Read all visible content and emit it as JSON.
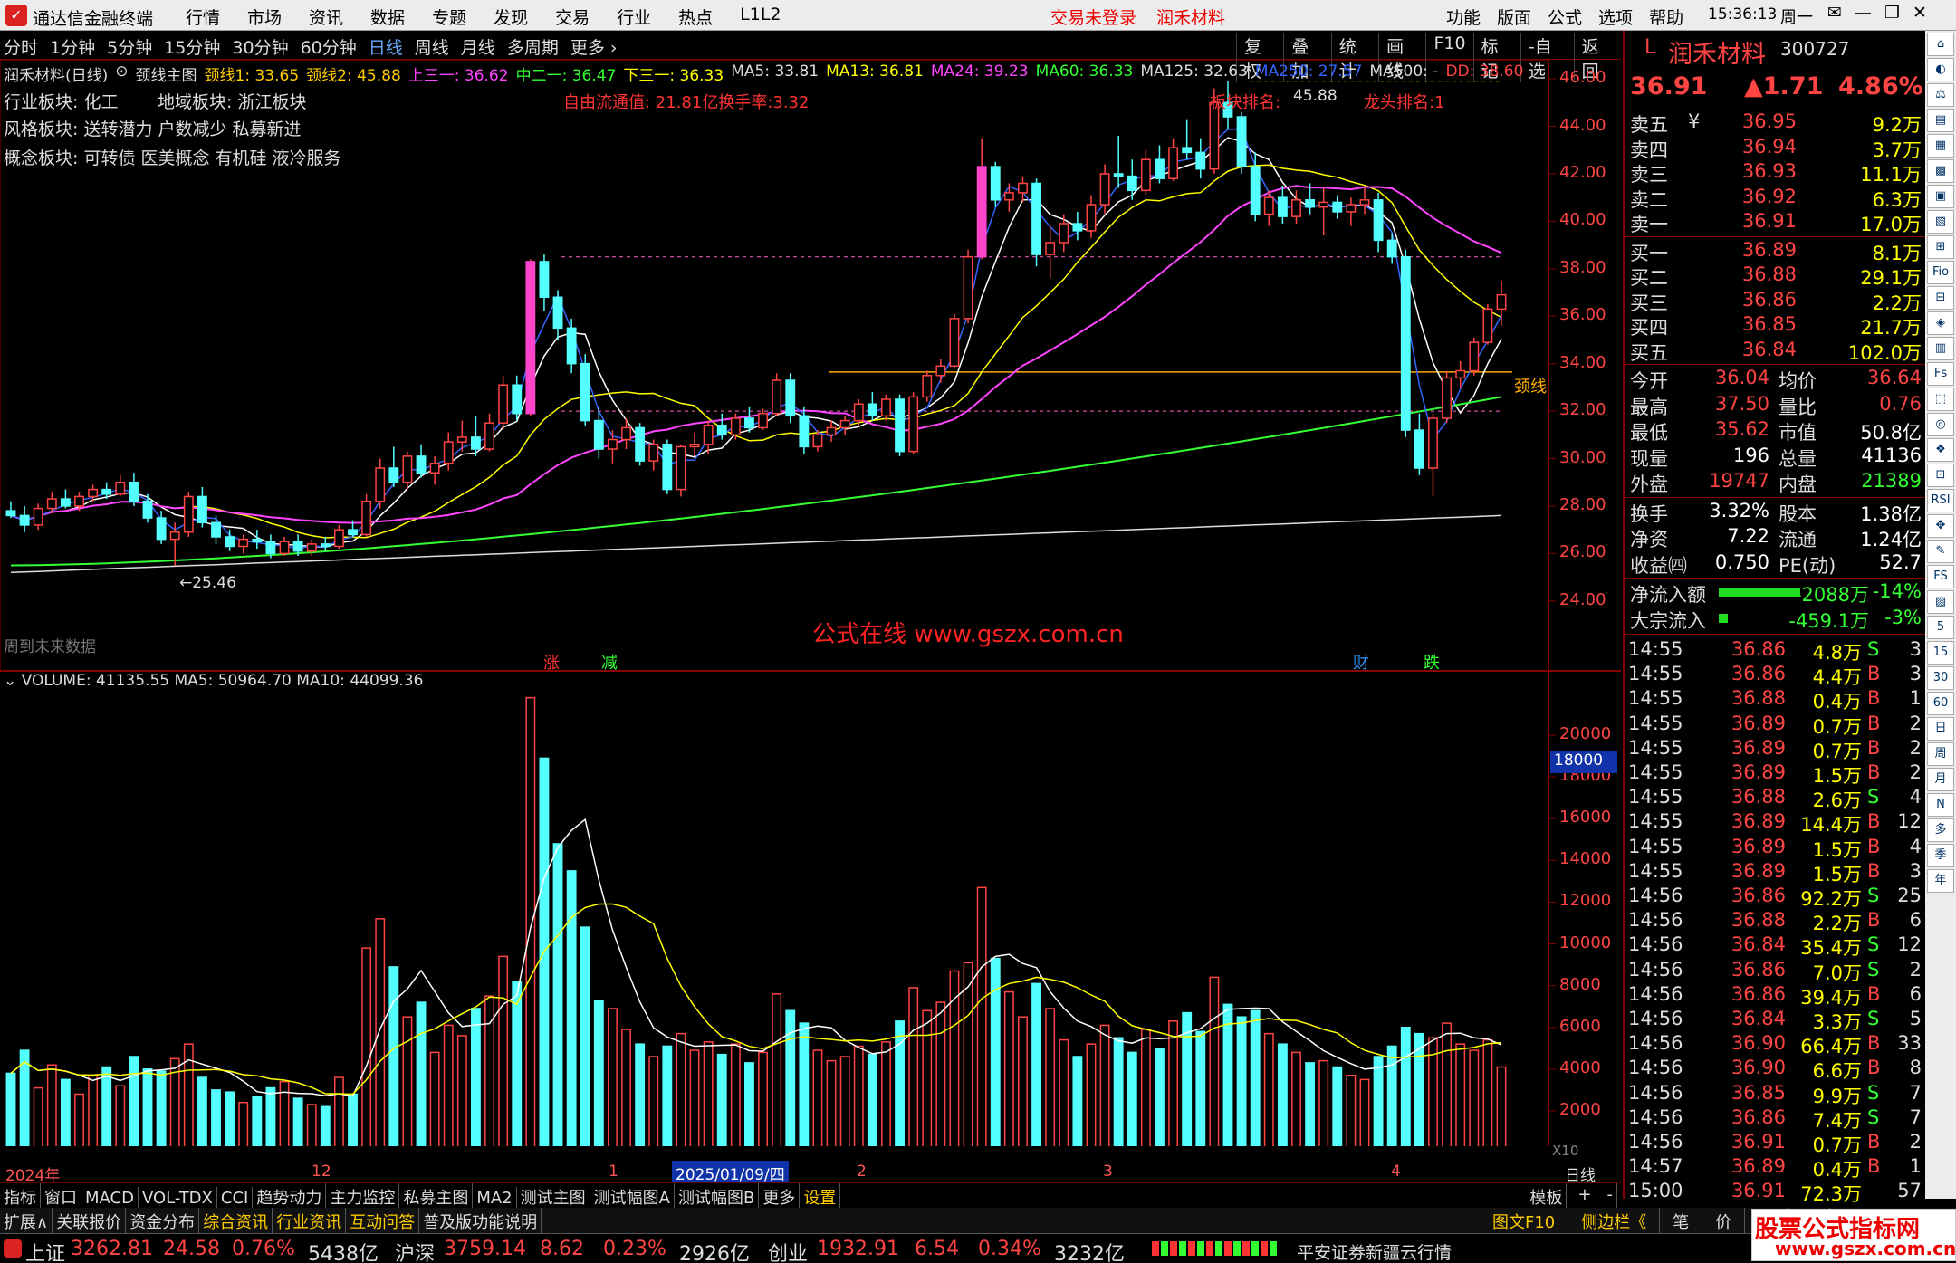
{
  "window": {
    "app_title": "通达信金融终端",
    "menus": [
      "行情",
      "市场",
      "资讯",
      "数据",
      "专题",
      "发现",
      "交易",
      "行业",
      "热点",
      "L1L2"
    ],
    "login": "交易未登录",
    "stock_title": "润禾材料",
    "right_menus": [
      "功能",
      "版面",
      "公式",
      "选项",
      "帮助"
    ],
    "clock": "15:36:13",
    "weekday": "周一",
    "win_buttons": [
      "✉",
      "—",
      "❐",
      "✕"
    ]
  },
  "periods": [
    {
      "label": "分时",
      "active": false
    },
    {
      "label": "1分钟",
      "active": false
    },
    {
      "label": "5分钟",
      "active": false
    },
    {
      "label": "15分钟",
      "active": false
    },
    {
      "label": "30分钟",
      "active": false
    },
    {
      "label": "60分钟",
      "active": false
    },
    {
      "label": "日线",
      "active": true
    },
    {
      "label": "周线",
      "active": false
    },
    {
      "label": "月线",
      "active": false
    },
    {
      "label": "多周期",
      "active": false
    },
    {
      "label": "更多 ›",
      "active": false
    }
  ],
  "tools": [
    "复权",
    "叠加",
    "统计",
    "画线",
    "F10",
    "标记",
    "-自选",
    "返回"
  ],
  "indicator_line": [
    {
      "text": "润禾材料(日线)",
      "color": "#dddddd"
    },
    {
      "text": "⊙",
      "color": "#dddddd"
    },
    {
      "text": "颈线主图",
      "color": "#dddddd"
    },
    {
      "text": "颈线1: 33.65",
      "color": "#ffcc00"
    },
    {
      "text": "颈线2: 45.88",
      "color": "#ffcc00"
    },
    {
      "text": "上三一: 36.62",
      "color": "#ff44ff"
    },
    {
      "text": "中二一: 36.47",
      "color": "#33ff33"
    },
    {
      "text": "下三一: 36.33",
      "color": "#ffff00"
    },
    {
      "text": "MA5: 33.81",
      "color": "#dddddd"
    },
    {
      "text": "MA13: 36.81",
      "color": "#ffff00"
    },
    {
      "text": "MA24: 39.23",
      "color": "#ff44ff"
    },
    {
      "text": "MA60: 36.33",
      "color": "#33ff33"
    },
    {
      "text": "MA125: 32.63",
      "color": "#dddddd"
    },
    {
      "text": "MA250: 27.57",
      "color": "#3366ff"
    },
    {
      "text": "MA500: -",
      "color": "#dddddd"
    },
    {
      "text": "DD: 38.60",
      "color": "#ff4444"
    }
  ],
  "sectors": {
    "industry": "行业板块: 化工",
    "region": "地域板块: 浙江板块",
    "style": "风格板块: 送转潜力 户数减少 私募新进",
    "concept": "概念板块: 可转债 医美概念 有机硅 液冷服务"
  },
  "annotations": {
    "float": "自由流通值: 21.81亿换手率:3.32",
    "sector_rank": "板块排名:",
    "high_label": "45.88",
    "leader_rank": "龙头排名:1",
    "neck": "颈线",
    "low_label": "←25.46",
    "watermark": "公式在线 www.gszx.com.cn",
    "future": "周到未来数据",
    "flags": [
      {
        "t": "涨",
        "c": "#ff3333"
      },
      {
        "t": "减",
        "c": "#33ff33"
      },
      {
        "t": "财",
        "c": "#3399ff"
      },
      {
        "t": "跌",
        "c": "#33ff33"
      }
    ]
  },
  "price_axis": [
    "46.00",
    "44.00",
    "42.00",
    "40.00",
    "38.00",
    "36.00",
    "34.00",
    "32.00",
    "30.00",
    "28.00",
    "26.00",
    "24.00"
  ],
  "volume_axis": [
    "20000",
    "18000",
    "16000",
    "14000",
    "12000",
    "10000",
    "8000",
    "6000",
    "4000",
    "2000"
  ],
  "volume_title": "VOLUME: 41135.55  MA5: 50964.70  MA10: 44099.36",
  "volume_marker": "18000",
  "x10": "X10",
  "date_axis": {
    "year": "2024年",
    "m12": "12",
    "m1": "1",
    "sel": "2025/01/09/四",
    "m2": "2",
    "m3": "3",
    "m4": "4",
    "right": "日线"
  },
  "chart_data": {
    "type": "candlestick",
    "title": "润禾材料(日线)",
    "ylim": [
      23,
      46.5
    ],
    "volume_ylim": [
      0,
      22000
    ],
    "candles": [
      [
        27.8,
        28.2,
        27.5,
        27.6,
        3800
      ],
      [
        27.6,
        28.0,
        26.9,
        27.2,
        4900
      ],
      [
        27.2,
        28.1,
        27.0,
        27.9,
        3100
      ],
      [
        27.9,
        28.6,
        27.7,
        28.3,
        4200
      ],
      [
        28.3,
        28.7,
        27.9,
        28.0,
        3500
      ],
      [
        28.0,
        28.6,
        27.8,
        28.4,
        2800
      ],
      [
        28.4,
        28.9,
        28.2,
        28.7,
        3700
      ],
      [
        28.7,
        29.0,
        28.3,
        28.5,
        4100
      ],
      [
        28.5,
        29.3,
        28.4,
        29.0,
        3200
      ],
      [
        29.0,
        29.4,
        28.0,
        28.2,
        4600
      ],
      [
        28.2,
        28.5,
        27.3,
        27.5,
        4000
      ],
      [
        27.5,
        27.8,
        26.4,
        26.6,
        3900
      ],
      [
        26.6,
        27.3,
        25.5,
        26.9,
        4500
      ],
      [
        26.9,
        28.6,
        26.7,
        28.4,
        5200
      ],
      [
        28.4,
        28.8,
        27.1,
        27.3,
        3600
      ],
      [
        27.3,
        27.6,
        26.4,
        26.7,
        3000
      ],
      [
        26.7,
        27.0,
        26.1,
        26.3,
        2900
      ],
      [
        26.3,
        26.8,
        26.0,
        26.6,
        2400
      ],
      [
        26.6,
        27.0,
        26.2,
        26.5,
        2700
      ],
      [
        26.5,
        26.8,
        25.8,
        26.0,
        3100
      ],
      [
        26.0,
        26.7,
        25.9,
        26.5,
        3400
      ],
      [
        26.5,
        26.8,
        25.9,
        26.1,
        2600
      ],
      [
        26.1,
        26.6,
        25.9,
        26.4,
        2300
      ],
      [
        26.4,
        26.7,
        26.1,
        26.3,
        2200
      ],
      [
        26.3,
        27.2,
        26.2,
        27.0,
        3600
      ],
      [
        27.0,
        27.4,
        26.7,
        26.8,
        2800
      ],
      [
        26.8,
        28.5,
        26.7,
        28.2,
        9800
      ],
      [
        28.2,
        30.0,
        27.9,
        29.6,
        11200
      ],
      [
        29.6,
        30.5,
        28.8,
        29.0,
        8900
      ],
      [
        29.0,
        30.3,
        28.7,
        30.1,
        6500
      ],
      [
        30.1,
        30.6,
        29.2,
        29.4,
        7200
      ],
      [
        29.4,
        30.1,
        28.9,
        29.8,
        4800
      ],
      [
        29.8,
        31.1,
        29.5,
        30.7,
        6100
      ],
      [
        30.7,
        31.6,
        30.3,
        30.9,
        5600
      ],
      [
        30.9,
        31.8,
        30.1,
        30.4,
        6900
      ],
      [
        30.4,
        31.9,
        30.3,
        31.5,
        7500
      ],
      [
        31.5,
        33.5,
        31.2,
        33.1,
        9400
      ],
      [
        33.1,
        33.5,
        31.6,
        31.9,
        8200
      ],
      [
        31.9,
        38.4,
        31.8,
        38.3,
        21800
      ],
      [
        38.3,
        38.6,
        36.2,
        36.8,
        18900
      ],
      [
        36.8,
        37.1,
        35.0,
        35.5,
        14800
      ],
      [
        35.5,
        35.9,
        33.6,
        34.0,
        13500
      ],
      [
        34.0,
        34.4,
        31.4,
        31.6,
        10800
      ],
      [
        31.6,
        32.2,
        30.0,
        30.4,
        7300
      ],
      [
        30.4,
        31.2,
        29.8,
        30.8,
        6900
      ],
      [
        30.8,
        31.7,
        30.4,
        31.3,
        5900
      ],
      [
        31.3,
        31.5,
        29.7,
        29.9,
        5200
      ],
      [
        29.9,
        30.8,
        29.5,
        30.6,
        4600
      ],
      [
        30.6,
        30.8,
        28.5,
        28.7,
        5100
      ],
      [
        28.7,
        30.6,
        28.4,
        30.5,
        5700
      ],
      [
        30.5,
        31.1,
        30.1,
        30.6,
        4900
      ],
      [
        30.6,
        31.6,
        30.2,
        31.4,
        5300
      ],
      [
        31.4,
        31.9,
        30.8,
        31.0,
        4700
      ],
      [
        31.0,
        31.9,
        30.8,
        31.7,
        5200
      ],
      [
        31.7,
        32.2,
        31.1,
        31.3,
        4300
      ],
      [
        31.3,
        32.1,
        31.2,
        31.9,
        4800
      ],
      [
        31.9,
        33.6,
        31.8,
        33.3,
        7600
      ],
      [
        33.3,
        33.6,
        31.5,
        31.8,
        6800
      ],
      [
        31.8,
        32.2,
        30.2,
        30.5,
        6200
      ],
      [
        30.5,
        31.2,
        30.3,
        31.0,
        4900
      ],
      [
        31.0,
        31.6,
        30.7,
        31.3,
        4400
      ],
      [
        31.3,
        31.8,
        31.0,
        31.6,
        4600
      ],
      [
        31.6,
        32.5,
        31.4,
        32.3,
        5100
      ],
      [
        32.3,
        32.8,
        31.6,
        31.8,
        4700
      ],
      [
        31.8,
        32.7,
        31.6,
        32.5,
        5300
      ],
      [
        32.5,
        32.7,
        30.1,
        30.3,
        6300
      ],
      [
        30.3,
        32.8,
        30.2,
        32.6,
        7900
      ],
      [
        32.6,
        33.7,
        32.4,
        33.5,
        6800
      ],
      [
        33.5,
        34.2,
        33.2,
        33.9,
        7200
      ],
      [
        33.9,
        36.1,
        33.8,
        35.9,
        8700
      ],
      [
        35.9,
        38.8,
        35.7,
        38.5,
        9100
      ],
      [
        38.5,
        43.5,
        38.4,
        42.3,
        12700
      ],
      [
        42.3,
        42.5,
        40.6,
        40.9,
        9300
      ],
      [
        40.9,
        41.6,
        40.4,
        41.2,
        7700
      ],
      [
        41.2,
        41.9,
        40.8,
        41.6,
        6500
      ],
      [
        41.6,
        41.8,
        38.1,
        38.6,
        8100
      ],
      [
        38.6,
        39.8,
        37.6,
        39.1,
        6900
      ],
      [
        39.1,
        40.3,
        38.7,
        39.9,
        5400
      ],
      [
        39.9,
        40.4,
        39.2,
        39.6,
        4600
      ],
      [
        39.6,
        41.1,
        39.3,
        40.7,
        5200
      ],
      [
        40.7,
        42.4,
        40.3,
        42.0,
        6100
      ],
      [
        42.0,
        43.6,
        41.4,
        41.9,
        5500
      ],
      [
        41.9,
        42.6,
        40.9,
        41.3,
        4800
      ],
      [
        41.3,
        43.0,
        41.1,
        42.6,
        5900
      ],
      [
        42.6,
        43.2,
        41.6,
        41.8,
        5000
      ],
      [
        41.8,
        43.5,
        41.7,
        43.1,
        6300
      ],
      [
        43.1,
        44.3,
        42.6,
        42.9,
        6700
      ],
      [
        42.9,
        43.5,
        41.8,
        42.2,
        5800
      ],
      [
        42.2,
        45.6,
        42.0,
        45.0,
        8400
      ],
      [
        45.0,
        45.9,
        43.9,
        44.4,
        7100
      ],
      [
        44.4,
        44.6,
        42.0,
        42.3,
        6500
      ],
      [
        42.3,
        42.9,
        40.0,
        40.3,
        6800
      ],
      [
        40.3,
        41.3,
        39.8,
        41.0,
        5700
      ],
      [
        41.0,
        41.5,
        39.9,
        40.2,
        5200
      ],
      [
        40.2,
        41.3,
        39.9,
        40.9,
        4800
      ],
      [
        40.9,
        41.6,
        40.3,
        40.6,
        4300
      ],
      [
        40.6,
        41.4,
        39.4,
        40.8,
        4400
      ],
      [
        40.8,
        41.1,
        40.1,
        40.4,
        4100
      ],
      [
        40.4,
        41.0,
        39.8,
        40.7,
        3700
      ],
      [
        40.7,
        41.4,
        40.3,
        40.9,
        3500
      ],
      [
        40.9,
        41.2,
        38.7,
        39.2,
        4600
      ],
      [
        39.2,
        39.5,
        38.2,
        38.5,
        5100
      ],
      [
        38.5,
        38.8,
        30.9,
        31.2,
        6000
      ],
      [
        31.2,
        31.9,
        29.3,
        29.6,
        5700
      ],
      [
        29.6,
        31.9,
        28.4,
        31.7,
        5500
      ],
      [
        31.7,
        33.7,
        31.5,
        33.4,
        6200
      ],
      [
        33.4,
        34.1,
        33.0,
        33.7,
        5200
      ],
      [
        33.7,
        35.1,
        33.5,
        34.9,
        4900
      ],
      [
        34.9,
        36.5,
        34.8,
        36.3,
        5400
      ],
      [
        36.3,
        37.5,
        35.6,
        36.9,
        4100
      ]
    ]
  },
  "quote": {
    "tag": "L",
    "name": "润禾材料",
    "code": "300727",
    "price": "36.91",
    "change": "▲1.71",
    "pct": "4.86%",
    "asks": [
      {
        "label": "卖五",
        "p": "36.95",
        "v": "9.2万",
        "sym": "¥"
      },
      {
        "label": "卖四",
        "p": "36.94",
        "v": "3.7万",
        "sym": ""
      },
      {
        "label": "卖三",
        "p": "36.93",
        "v": "11.1万",
        "sym": ""
      },
      {
        "label": "卖二",
        "p": "36.92",
        "v": "6.3万",
        "sym": ""
      },
      {
        "label": "卖一",
        "p": "36.91",
        "v": "17.0万",
        "sym": ""
      }
    ],
    "bids": [
      {
        "label": "买一",
        "p": "36.89",
        "v": "8.1万"
      },
      {
        "label": "买二",
        "p": "36.88",
        "v": "29.1万"
      },
      {
        "label": "买三",
        "p": "36.86",
        "v": "2.2万"
      },
      {
        "label": "买四",
        "p": "36.85",
        "v": "21.7万"
      },
      {
        "label": "买五",
        "p": "36.84",
        "v": "102.0万"
      }
    ],
    "stats": [
      [
        "今开",
        "36.04",
        "#ff4444",
        "均价",
        "36.64",
        "#ff4444"
      ],
      [
        "最高",
        "37.50",
        "#ff4444",
        "量比",
        "0.76",
        "#ff4444"
      ],
      [
        "最低",
        "35.62",
        "#ff4444",
        "市值",
        "50.8亿",
        "#ffffff"
      ],
      [
        "现量",
        "196",
        "#ffffff",
        "总量",
        "41136",
        "#ffffff"
      ],
      [
        "外盘",
        "19747",
        "#ff4444",
        "内盘",
        "21389",
        "#33ff33"
      ]
    ],
    "stats2": [
      [
        "换手",
        "3.32%",
        "#ffffff",
        "股本",
        "1.38亿",
        "#ffffff"
      ],
      [
        "净资",
        "7.22",
        "#ffffff",
        "流通",
        "1.24亿",
        "#ffffff"
      ],
      [
        "收益㈣",
        "0.750",
        "#ffffff",
        "PE(动)",
        "52.7",
        "#ffffff"
      ]
    ],
    "flows": [
      {
        "label": "净流入额",
        "v": "-2088万",
        "p": "-14%",
        "bar": 0.9
      },
      {
        "label": "大宗流入",
        "v": "-459.1万",
        "p": "-3%",
        "bar": 0.1
      }
    ],
    "ticks": [
      [
        "14:55",
        "36.86",
        "4.8万",
        "S",
        "3"
      ],
      [
        "14:55",
        "36.86",
        "4.4万",
        "B",
        "3"
      ],
      [
        "14:55",
        "36.88",
        "0.4万",
        "B",
        "1"
      ],
      [
        "14:55",
        "36.89",
        "0.7万",
        "B",
        "2"
      ],
      [
        "14:55",
        "36.89",
        "0.7万",
        "B",
        "2"
      ],
      [
        "14:55",
        "36.89",
        "1.5万",
        "B",
        "2"
      ],
      [
        "14:55",
        "36.88",
        "2.6万",
        "S",
        "4"
      ],
      [
        "14:55",
        "36.89",
        "14.4万",
        "B",
        "12"
      ],
      [
        "14:55",
        "36.89",
        "1.5万",
        "B",
        "4"
      ],
      [
        "14:55",
        "36.89",
        "1.5万",
        "B",
        "3"
      ],
      [
        "14:56",
        "36.86",
        "92.2万",
        "S",
        "25"
      ],
      [
        "14:56",
        "36.88",
        "2.2万",
        "B",
        "6"
      ],
      [
        "14:56",
        "36.84",
        "35.4万",
        "S",
        "12"
      ],
      [
        "14:56",
        "36.86",
        "7.0万",
        "S",
        "2"
      ],
      [
        "14:56",
        "36.86",
        "39.4万",
        "B",
        "6"
      ],
      [
        "14:56",
        "36.84",
        "3.3万",
        "S",
        "5"
      ],
      [
        "14:56",
        "36.90",
        "66.4万",
        "B",
        "33"
      ],
      [
        "14:56",
        "36.90",
        "6.6万",
        "B",
        "8"
      ],
      [
        "14:56",
        "36.85",
        "9.9万",
        "S",
        "7"
      ],
      [
        "14:56",
        "36.86",
        "7.4万",
        "S",
        "7"
      ],
      [
        "14:56",
        "36.91",
        "0.7万",
        "B",
        "2"
      ],
      [
        "14:57",
        "36.89",
        "0.4万",
        "B",
        "1"
      ],
      [
        "15:00",
        "36.91",
        "72.3万",
        "",
        "57"
      ]
    ]
  },
  "sidebar": [
    "⌂",
    "◐",
    "⚖",
    "▤",
    "▦",
    "▩",
    "▣",
    "▧",
    "⊞",
    "Fio",
    "⊟",
    "◈",
    "▥",
    "Fs",
    "⬚",
    "◎",
    "❖",
    "⊡",
    "RSI",
    "✥",
    "✎",
    "FS",
    "▨",
    "5",
    "15",
    "30",
    "60",
    "日",
    "周",
    "月",
    "N",
    "多",
    "季",
    "年"
  ],
  "tabs_bottom1": [
    "指标",
    "窗口",
    "MACD",
    "VOL-TDX",
    "CCI",
    "趋势动力",
    "主力监控",
    "私募主图",
    "MA2",
    "测试主图",
    "测试幅图A",
    "测试幅图B",
    "更多",
    "设置"
  ],
  "tabs_bottom1_right": [
    "模板",
    "+",
    "-"
  ],
  "tabs_bottom2": [
    "扩展∧",
    "关联报价",
    "资金分布",
    "综合资讯",
    "行业资讯",
    "互动问答",
    "普及版功能说明"
  ],
  "tabs_bottom2_right": [
    "图文F10",
    "侧边栏《",
    "笔",
    "价",
    "细",
    "势"
  ],
  "status": {
    "sh_name": "上证",
    "sh_val": "3262.81",
    "sh_chg": "24.58",
    "sh_pct": "0.76%",
    "sh_amt": "5438亿",
    "hs_name": "沪深",
    "hs_val": "3759.14",
    "hs_chg": "8.62",
    "hs_pct": "0.23%",
    "hs_amt": "2926亿",
    "cy_name": "创业",
    "cy_val": "1932.91",
    "cy_chg": "6.54",
    "cy_pct": "0.34%",
    "cy_amt": "3232亿",
    "broker": "平安证券新疆云行情",
    "brand": "股票公式指标网",
    "brand_url": "www.gszx.com.cn"
  }
}
